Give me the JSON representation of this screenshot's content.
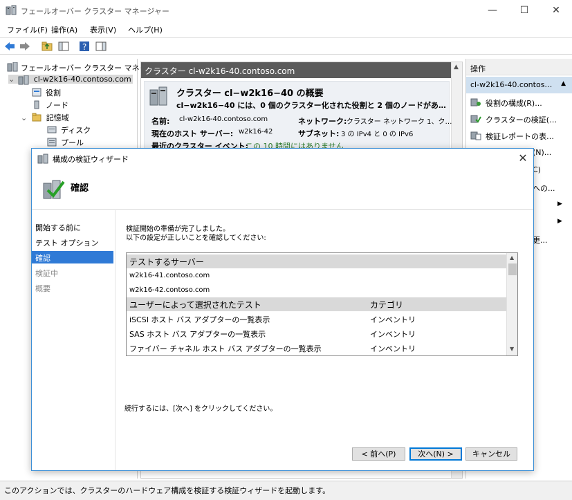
{
  "window": {
    "title": "フェールオーバー クラスター マネージャー",
    "controls": {
      "minimize": "—",
      "maximize": "☐",
      "close": "✕"
    }
  },
  "menu": [
    "ファイル(F)",
    "操作(A)",
    "表示(V)",
    "ヘルプ(H)"
  ],
  "tree": {
    "root": "フェールオーバー クラスター マネージャー",
    "cluster": "cl-w2k16-40.contoso.com",
    "children": [
      "役割",
      "ノード",
      "記憶域"
    ],
    "storage_children": [
      "ディスク",
      "プール"
    ]
  },
  "center": {
    "header": "クラスター cl-w2k16-40.contoso.com",
    "summary_title": "クラスター cl−w2k16−40 の概要",
    "summary_desc": "cl−w2k16−40 には、0 個のクラスター化された役割と 2 個のノードがあ…",
    "name_label": "名前:",
    "name_value": "cl-w2k16-40.contoso.com",
    "network_label": "ネットワーク:",
    "network_value": "クラスター ネットワーク 1、ク…",
    "host_label": "現在のホスト サーバー:",
    "host_value": "w2k16-42",
    "subnet_label": "サブネット:",
    "subnet_value": "3 の IPv4 と 0 の IPv6",
    "events_label": "最近のクラスター イベント:",
    "events_value": "この 10 時間にはありません"
  },
  "actions": {
    "header": "操作",
    "subheader": "cl-w2k16-40.contos…",
    "items": [
      "役割の構成(R)...",
      "クラスターの検証(…",
      "検証レポートの表…",
      "(N)...",
      "C)",
      "への...",
      "更..."
    ]
  },
  "status": {
    "text": "このアクションでは、クラスターのハードウェア構成を検証する検証ウィザードを起動します。"
  },
  "wizard": {
    "title": "構成の検証ウィザード",
    "heading": "確認",
    "steps": [
      "開始する前に",
      "テスト オプション",
      "確認",
      "検証中",
      "概要"
    ],
    "active_step": 2,
    "intro_line1": "検証開始の準備が完了しました。",
    "intro_line2": "以下の設定が正しいことを確認してください:",
    "servers_header": "テストするサーバー",
    "servers": [
      "w2k16-41.contoso.com",
      "w2k16-42.contoso.com"
    ],
    "tests_header": "ユーザーによって選択されたテスト",
    "category_header": "カテゴリ",
    "tests": [
      {
        "name": "iSCSI ホスト バス アダプターの一覧表示",
        "category": "インベントリ"
      },
      {
        "name": "SAS ホスト バス アダプターの一覧表示",
        "category": "インベントリ"
      },
      {
        "name": "ファイバー チャネル ホスト バス アダプターの一覧表示",
        "category": "インベントリ"
      }
    ],
    "continue_text": "続行するには、[次へ] をクリックしてください。",
    "buttons": {
      "back": "< 前へ(P)",
      "next": "次へ(N) >",
      "cancel": "キャンセル"
    }
  }
}
